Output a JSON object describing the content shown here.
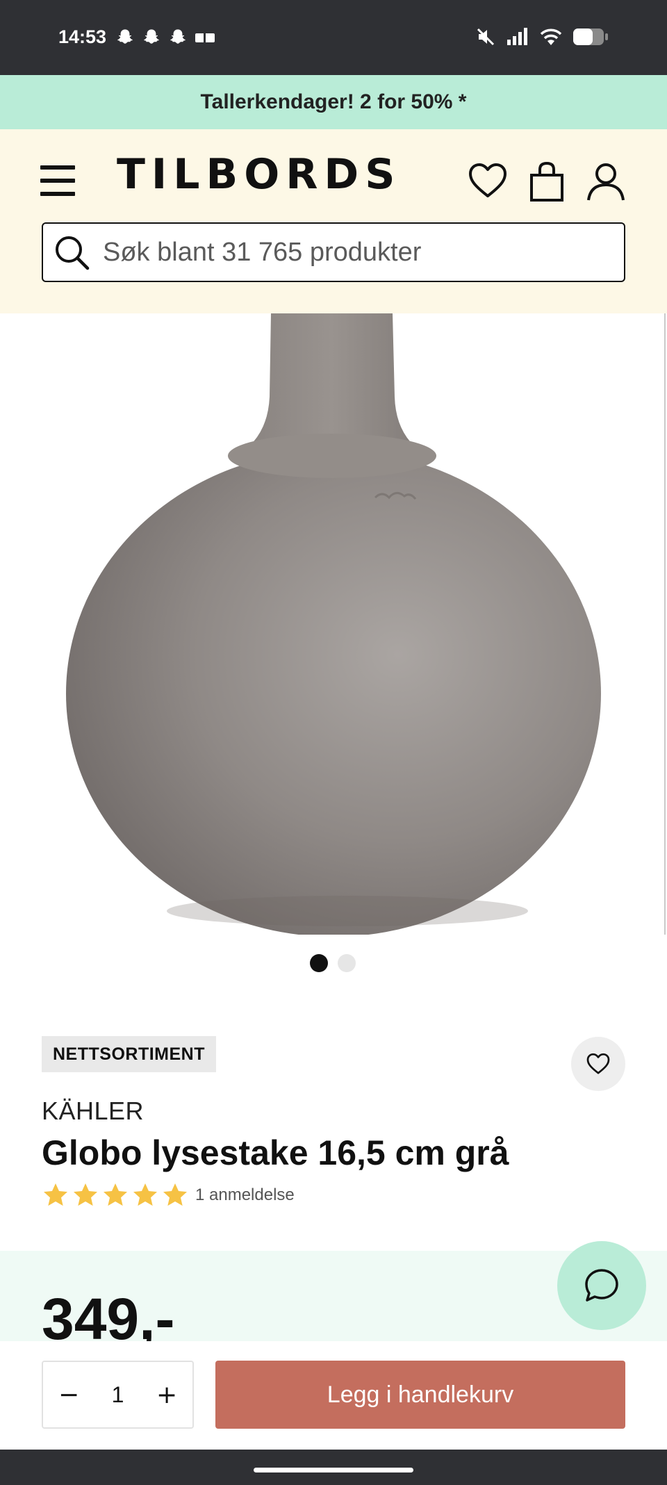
{
  "status_bar": {
    "time": "14:53",
    "app_icons": [
      "snapchat-icon",
      "snapchat-icon",
      "snapchat-icon",
      "message-icon"
    ],
    "right_icons": [
      "mute-icon",
      "signal-icon",
      "wifi-icon",
      "battery-icon"
    ]
  },
  "promo": {
    "text": "Tallerkendager! 2 for 50% *"
  },
  "header": {
    "logo": "TILBORDS",
    "search_placeholder": "Søk blant 31 765 produkter"
  },
  "gallery": {
    "slide_count": 2,
    "active_index": 0
  },
  "product": {
    "badge": "NETTSORTIMENT",
    "brand": "KÄHLER",
    "title": "Globo lysestake 16,5 cm grå",
    "rating": 5,
    "reviews": "1 anmeldelse",
    "price": "349,-"
  },
  "cart": {
    "minus": "−",
    "quantity": "1",
    "plus": "+",
    "add_label": "Legg i handlekurv"
  },
  "colors": {
    "promo_bg": "#b9ecd7",
    "header_bg": "#fdf8e6",
    "price_bg": "#effaf5",
    "cta": "#c46e5e",
    "star": "#f6c244"
  }
}
